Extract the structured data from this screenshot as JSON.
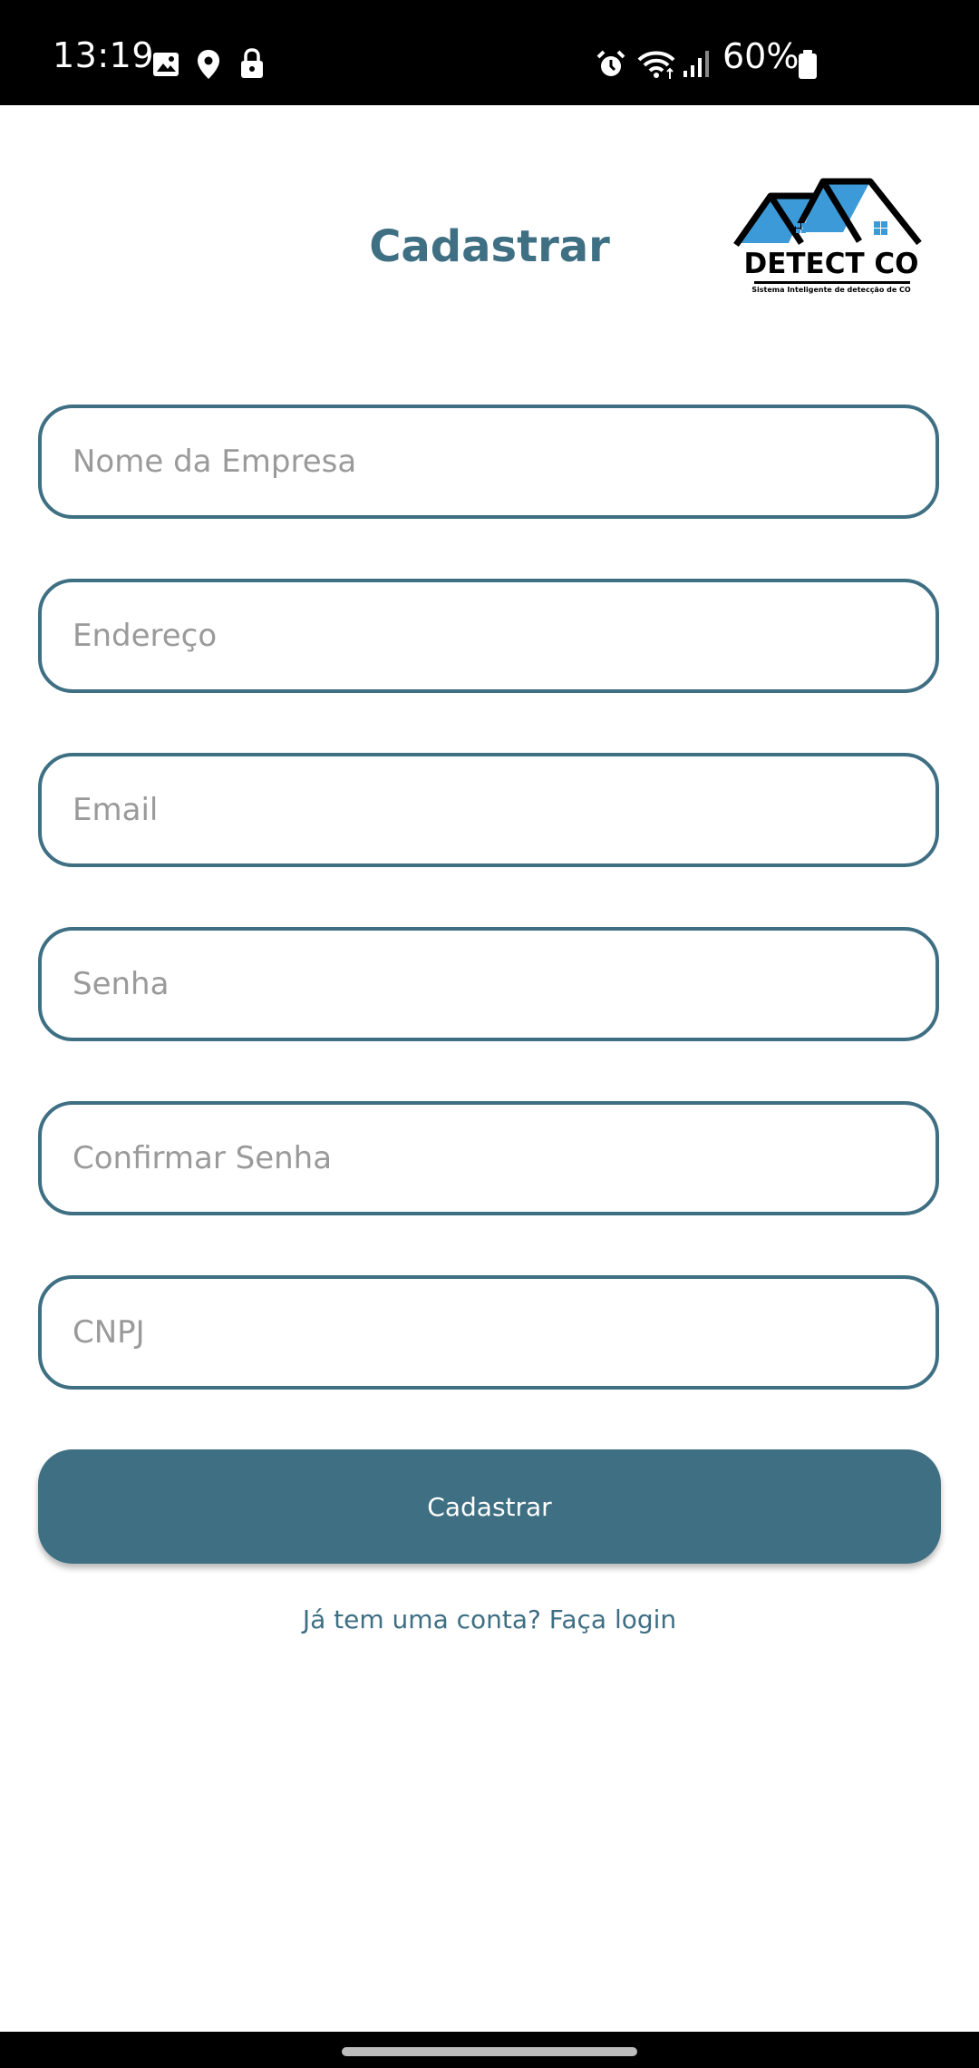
{
  "status_bar": {
    "time": "13:19",
    "battery_percent": "60%",
    "icons": [
      "gallery-icon",
      "location-icon",
      "lock-icon",
      "alarm-icon",
      "wifi-icon",
      "signal-icon",
      "battery-icon"
    ]
  },
  "header": {
    "title": "Cadastrar",
    "logo": {
      "name": "DETECT CO",
      "tagline": "Sistema Inteligente de detecção de CO",
      "roof_color": "#3d9ad8"
    }
  },
  "form": {
    "fields": [
      {
        "placeholder": "Nome da Empresa",
        "value": ""
      },
      {
        "placeholder": "Endereço",
        "value": ""
      },
      {
        "placeholder": "Email",
        "value": ""
      },
      {
        "placeholder": "Senha",
        "value": ""
      },
      {
        "placeholder": "Confirmar Senha",
        "value": ""
      },
      {
        "placeholder": "CNPJ",
        "value": ""
      }
    ],
    "submit_label": "Cadastrar",
    "login_link": "Já tem uma conta? Faça login"
  },
  "colors": {
    "primary": "#3e6f83",
    "placeholder": "#9a9a9a",
    "background": "#ffffff"
  }
}
